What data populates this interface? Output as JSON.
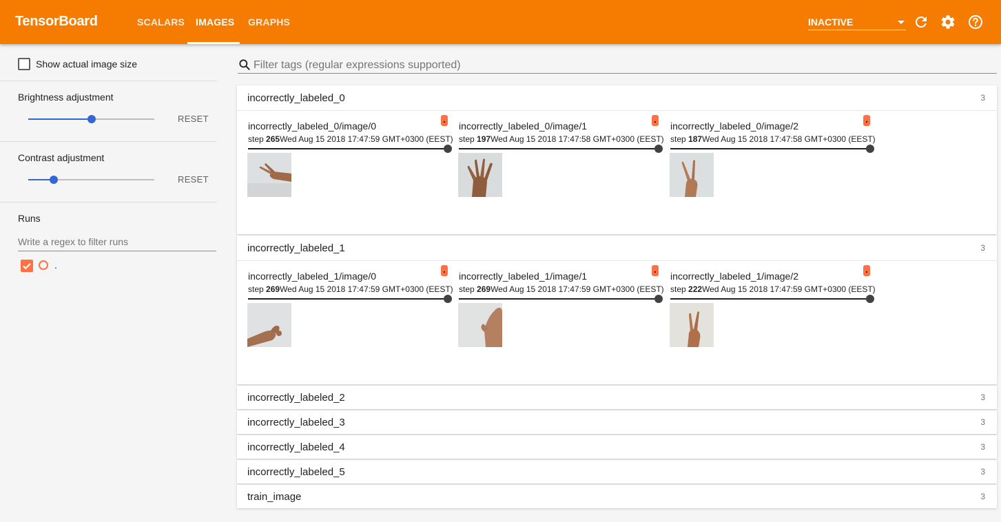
{
  "header": {
    "brand": "TensorBoard",
    "tabs": [
      {
        "label": "SCALARS",
        "active": false
      },
      {
        "label": "IMAGES",
        "active": true
      },
      {
        "label": "GRAPHS",
        "active": false
      }
    ],
    "inactive_label": "INACTIVE",
    "icons": [
      "refresh-icon",
      "gear-icon",
      "help-icon"
    ]
  },
  "sidebar": {
    "show_actual_size": "Show actual image size",
    "brightness": {
      "label": "Brightness adjustment",
      "reset": "RESET",
      "level": 0.5
    },
    "contrast": {
      "label": "Contrast adjustment",
      "reset": "RESET",
      "level": 0.2
    },
    "runs": {
      "title": "Runs",
      "placeholder": "Write a regex to filter runs",
      "items": [
        {
          "name": "."
        }
      ]
    }
  },
  "main": {
    "filter_placeholder": "Filter tags (regular expressions supported)",
    "groups": [
      {
        "title": "incorrectly_labeled_0",
        "count": "3",
        "expanded": true,
        "panes": [
          {
            "tag": "incorrectly_labeled_0/image/0",
            "step_label": "step",
            "step": "265",
            "time": "Wed Aug 15 2018 17:47:59 GMT+0300 (EEST)",
            "image": "hand-image-0-0"
          },
          {
            "tag": "incorrectly_labeled_0/image/1",
            "step_label": "step",
            "step": "197",
            "time": "Wed Aug 15 2018 17:47:58 GMT+0300 (EEST)",
            "image": "hand-image-0-1"
          },
          {
            "tag": "incorrectly_labeled_0/image/2",
            "step_label": "step",
            "step": "187",
            "time": "Wed Aug 15 2018 17:47:58 GMT+0300 (EEST)",
            "image": "hand-image-0-2"
          }
        ]
      },
      {
        "title": "incorrectly_labeled_1",
        "count": "3",
        "expanded": true,
        "panes": [
          {
            "tag": "incorrectly_labeled_1/image/0",
            "step_label": "step",
            "step": "269",
            "time": "Wed Aug 15 2018 17:47:59 GMT+0300 (EEST)",
            "image": "hand-image-1-0"
          },
          {
            "tag": "incorrectly_labeled_1/image/1",
            "step_label": "step",
            "step": "269",
            "time": "Wed Aug 15 2018 17:47:59 GMT+0300 (EEST)",
            "image": "hand-image-1-1"
          },
          {
            "tag": "incorrectly_labeled_1/image/2",
            "step_label": "step",
            "step": "222",
            "time": "Wed Aug 15 2018 17:47:59 GMT+0300 (EEST)",
            "image": "hand-image-1-2"
          }
        ]
      },
      {
        "title": "incorrectly_labeled_2",
        "count": "3",
        "expanded": false
      },
      {
        "title": "incorrectly_labeled_3",
        "count": "3",
        "expanded": false
      },
      {
        "title": "incorrectly_labeled_4",
        "count": "3",
        "expanded": false
      },
      {
        "title": "incorrectly_labeled_5",
        "count": "3",
        "expanded": false
      },
      {
        "title": "train_image",
        "count": "3",
        "expanded": false
      }
    ]
  }
}
